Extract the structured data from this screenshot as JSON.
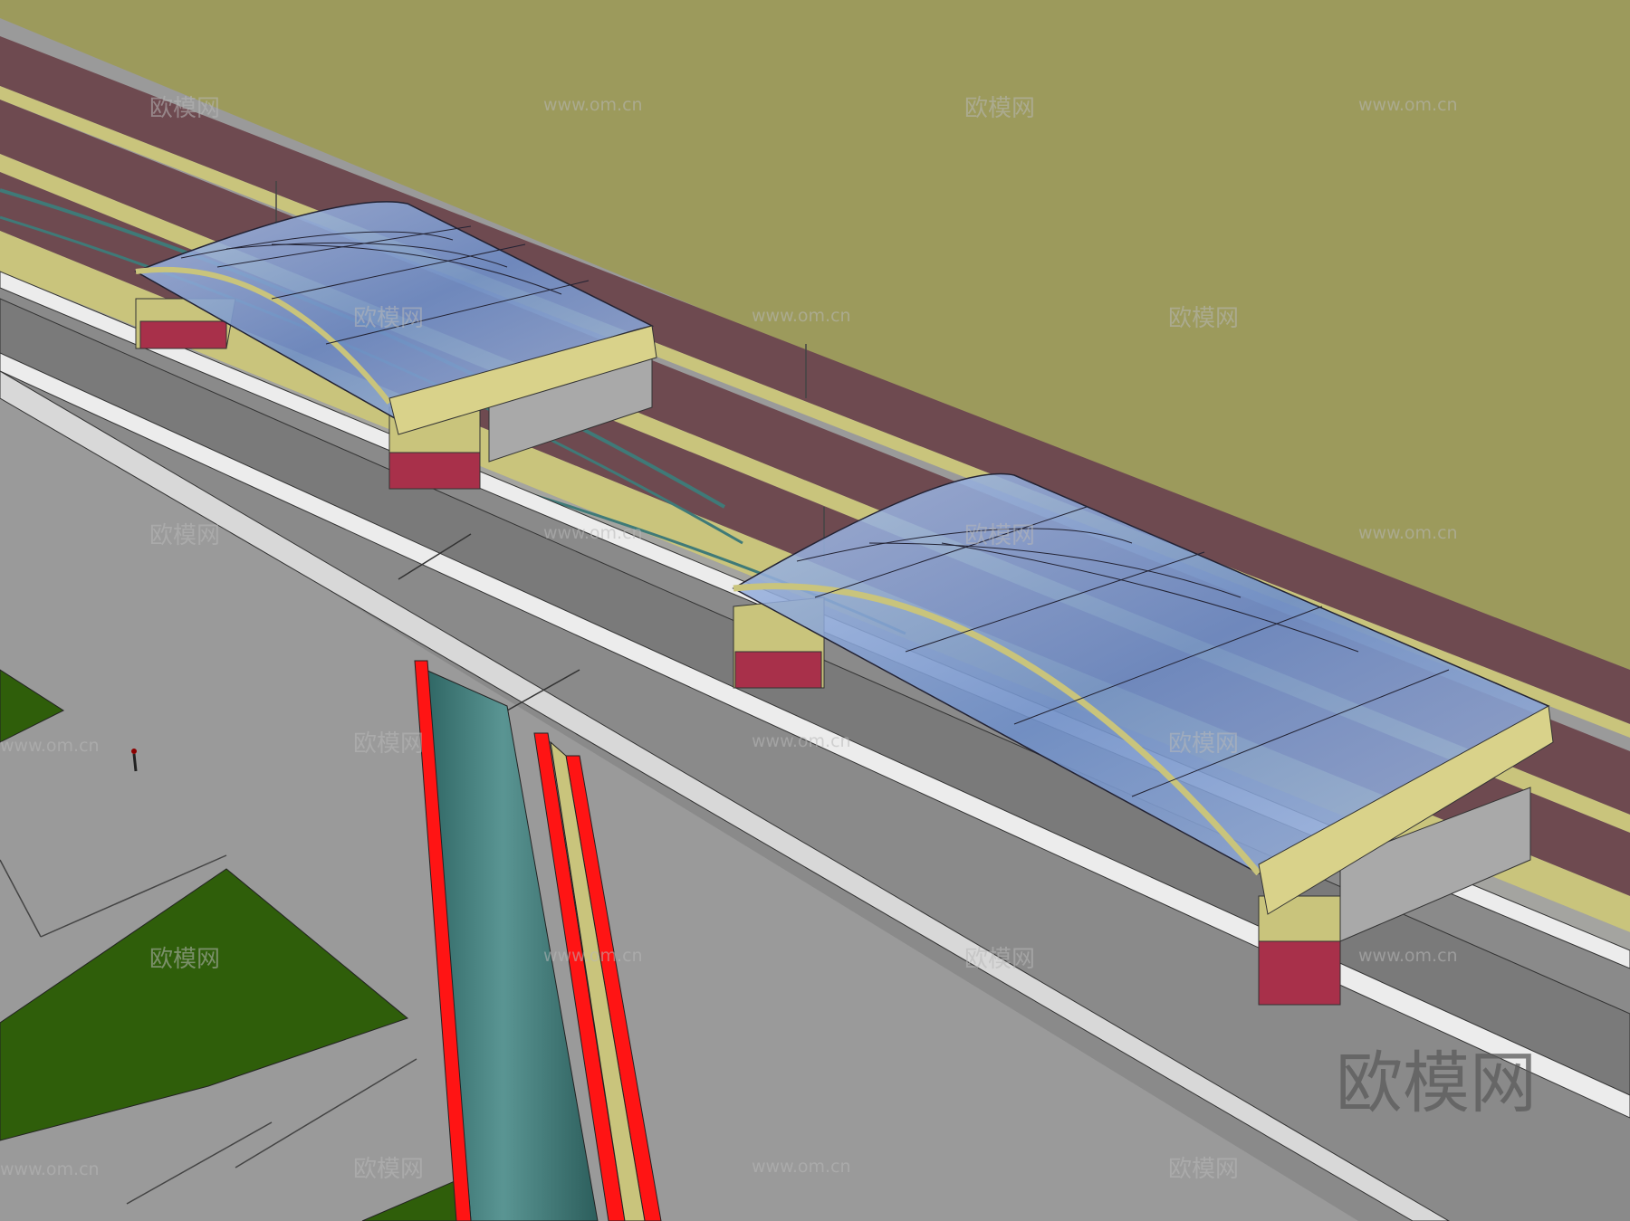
{
  "watermark": {
    "logo_text": "欧模网",
    "url_text": "www.om.cn",
    "corner_logo_text": "欧模网"
  },
  "colors": {
    "ground": "#9a9a9a",
    "wall_olive": "#9c9a5c",
    "wall_stripe_maroon": "#6e4a50",
    "wall_trim_yellow": "#c9c47c",
    "bridge_deck": "#7a7a7a",
    "bridge_edge": "#ececec",
    "pillar_teal": "#3f7a78",
    "pillar_red": "#ff1414",
    "canopy_glass": "#6f8fc8",
    "canopy_frame": "#d9d28a",
    "lawn_green": "#2f5e0a"
  },
  "objects": {
    "elevated_bridge": "elevated-bridge",
    "canopy_1": "glass-canopy-upper",
    "canopy_2": "glass-canopy-lower",
    "pillar": "bridge-pillar",
    "person": "pedestrian-figure"
  }
}
